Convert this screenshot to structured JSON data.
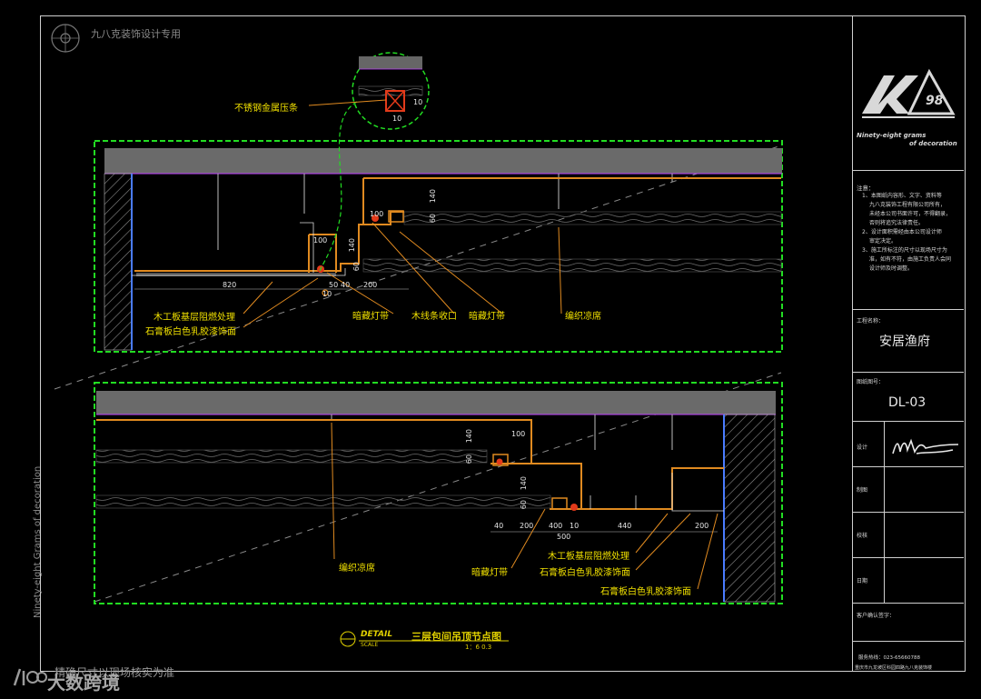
{
  "watermark_top": "九八克装饰设计专用",
  "watermark_side": "Ninety-eight Grams of decoration",
  "watermark_bottom": "精确尺寸以现场核实为准",
  "watermark_brand": "大数跨境",
  "detail_callout": {
    "label": "不锈钢金属压条",
    "dims": [
      "10",
      "10"
    ]
  },
  "upper_section": {
    "labels": {
      "wood_fire": "木工板基层阻燃处理",
      "gypsum": "石膏板白色乳胶漆饰面",
      "led1": "暗藏灯带",
      "wood_trim": "木线条收口",
      "led2": "暗藏灯带",
      "woven": "编织凉席"
    },
    "dims": [
      "820",
      "50",
      "40",
      "200",
      "100",
      "140",
      "60",
      "100",
      "140",
      "60",
      "10"
    ]
  },
  "lower_section": {
    "labels": {
      "woven": "编织凉席",
      "led": "暗藏灯带",
      "wood_fire": "木工板基层阻燃处理",
      "gypsum1": "石膏板白色乳胶漆饰面",
      "gypsum2": "石膏板白色乳胶漆饰面"
    },
    "dims": [
      "140",
      "100",
      "60",
      "140",
      "60",
      "40",
      "200",
      "400",
      "10",
      "440",
      "200",
      "500"
    ]
  },
  "caption": {
    "detail_word": "DETAIL",
    "scale_word": "SCALE",
    "title": "三层包间吊顶节点图",
    "scale": "1：6   0.3"
  },
  "title_block": {
    "logo_text": "KA",
    "logo_num": "98",
    "company_en_1": "Ninety-eight grams",
    "company_en_2": "of decoration",
    "notes_title": "注意：",
    "notes": [
      "1、本图纸内容形、文字、资料等",
      "九八克装饰工程有限公司所有，",
      "未经本公司书面许可，不得翻录，",
      "否则将追究法律责任。",
      "2、设计面积需经由本公司设计师",
      "审定决定。",
      "3、施工所标注的尺寸以现场尺寸为",
      "准，如有不符，由施工负责人会同",
      "设计师及时调整。"
    ],
    "project_label": "工程名称：",
    "project_name": "安居渔府",
    "drawing_no_label": "图纸图号：",
    "drawing_no": "DL-03",
    "design_label": "设计",
    "draw_label": "制图",
    "check_label": "校核",
    "date_label": "日期",
    "client_label": "客户确认签字：",
    "phone": "服务热线：023-65660788",
    "address": "重庆市九龙坡区科园四路九八克装饰楼"
  }
}
